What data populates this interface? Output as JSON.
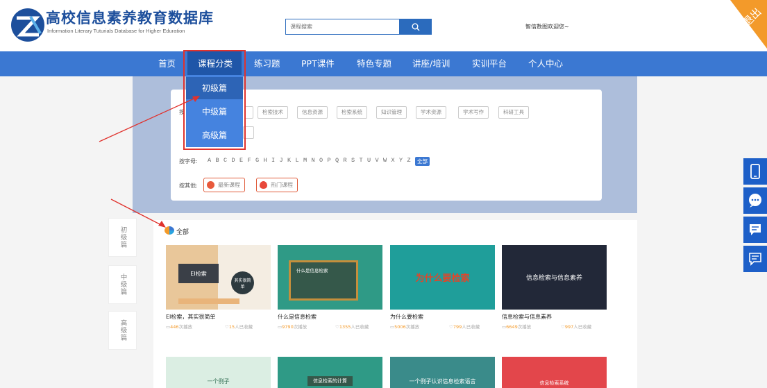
{
  "header": {
    "logo_cn": "高校信息素养教育数据库",
    "logo_en": "Information Literary Tuturials Database for Higher Eduration",
    "search_placeholder": "课程搜索",
    "welcome": "智信数图欢迎您~",
    "logout": "退出"
  },
  "nav": {
    "items": [
      "首页",
      "课程分类",
      "练习题",
      "PPT课件",
      "特色专题",
      "讲座/培训",
      "实训平台",
      "个人中心"
    ],
    "active": "课程分类",
    "dropdown": [
      "初级篇",
      "中级篇",
      "高级篇"
    ]
  },
  "filters": {
    "row1_label": "按",
    "row1_tags": [
      "检索技术",
      "信息资源",
      "检索系统",
      "知识管理",
      "学术资源",
      "学术写作",
      "科研工具"
    ],
    "letter_label": "按字母:",
    "letters": [
      "A",
      "B",
      "C",
      "D",
      "E",
      "F",
      "G",
      "H",
      "I",
      "J",
      "K",
      "L",
      "M",
      "N",
      "O",
      "P",
      "Q",
      "R",
      "S",
      "T",
      "U",
      "V",
      "W",
      "X",
      "Y",
      "Z"
    ],
    "letter_all": "全部",
    "other_label": "按其他:",
    "other": [
      "最新课程",
      "热门课程"
    ]
  },
  "content": {
    "section_title": "全部",
    "side_tabs": [
      "初级篇",
      "中级篇",
      "高级篇"
    ],
    "courses": [
      {
        "title": "EI检索，其实很简单",
        "plays": "446",
        "plays_suffix": "次播放",
        "favs": "15",
        "favs_suffix": "人已收藏",
        "thumb_text": "EI检索",
        "thumb_badge": "其实很简单"
      },
      {
        "title": "什么是信息检索",
        "plays": "9790",
        "plays_suffix": "次播放",
        "favs": "1355",
        "favs_suffix": "人已收藏",
        "thumb_text": "什么是信息检索"
      },
      {
        "title": "为什么要检索",
        "plays": "5006",
        "plays_suffix": "次播放",
        "favs": "799",
        "favs_suffix": "人已收藏",
        "thumb_text": "为什么要检索"
      },
      {
        "title": "信息检索与信息素养",
        "plays": "6649",
        "plays_suffix": "次播放",
        "favs": "997",
        "favs_suffix": "人已收藏",
        "thumb_text": "信息检索与信息素养"
      }
    ],
    "row2_thumbs": [
      "一个例子",
      "信息检索的计算",
      "一个例子认识信息检索语言",
      "信息检索系统"
    ]
  },
  "colors": {
    "nav": "#3b78d2",
    "nav_active": "#1f56a8",
    "accent_orange": "#f39a2a",
    "annotation_red": "#e0322d"
  }
}
